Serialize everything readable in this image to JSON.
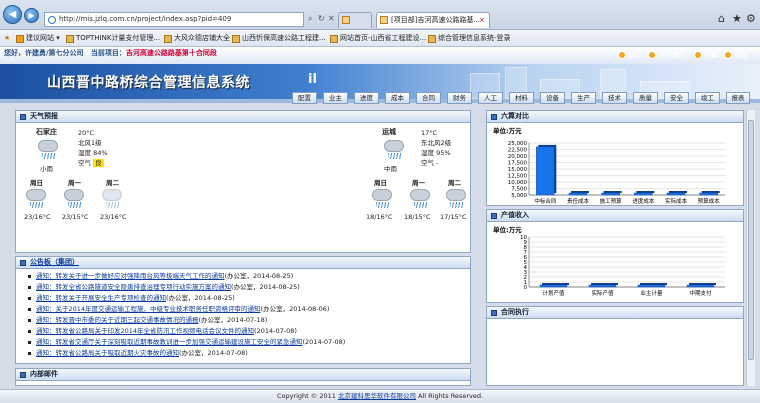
{
  "browser": {
    "url": "http://mis.jzlq.com.cn/project/index.asp?pid=409",
    "tabs": [
      "[项目部]吉河高速公路路基...",
      "[项目部]吉河高速公路路基..."
    ],
    "active_tab_close": "×"
  },
  "favorites": [
    "建议网站 ▾",
    "TOPTHINK计量支付管理...",
    "大风众德店铺大全",
    "山西忻保高速公路工程建...",
    "网站首页-山西省工程建设...",
    "综合管理信息系统-登录"
  ],
  "header": {
    "welcome": "您好，许建勇/第七分公司",
    "current_project_label": "当前项目：",
    "current_project": "吉河高速公路路基第十合同段",
    "system_title": "山西晋中路桥综合管理信息系统",
    "title_suffix": "il",
    "toplinks": [
      "首页",
      "项目首页",
      "帮助",
      "退出"
    ],
    "menu": [
      "配置",
      "业主",
      "进度",
      "成本",
      "合同",
      "财务",
      "人工",
      "材料",
      "设备",
      "生产",
      "技术",
      "质量",
      "安全",
      "竣工",
      "报表"
    ]
  },
  "weather": {
    "title": "天气预报",
    "cities": [
      {
        "name": "石家庄",
        "temp": "20°C",
        "wind": "北风1级",
        "humidity": "湿度 84%",
        "air_label": "空气",
        "air": "良",
        "condition": "小雨",
        "days": [
          {
            "day": "周日",
            "temp": "23/16°C"
          },
          {
            "day": "周一",
            "temp": "23/15°C"
          },
          {
            "day": "周二",
            "temp": "23/16°C"
          }
        ]
      },
      {
        "name": "运城",
        "temp": "17°C",
        "wind": "东北风2级",
        "humidity": "湿度 95%",
        "air_label": "空气",
        "air": "-",
        "condition": "中雨",
        "days": [
          {
            "day": "周日",
            "temp": "18/16°C"
          },
          {
            "day": "周一",
            "temp": "18/15°C"
          },
          {
            "day": "周二",
            "temp": "17/15°C"
          }
        ]
      }
    ]
  },
  "notices": {
    "title": "公告板（集团）",
    "items": [
      {
        "link": "通知：转发关于进一步做好应对强降雨台风等极端天气工作的通知",
        "src": "(办公室，2014-08-25)"
      },
      {
        "link": "通知：转发全省公路隧道安全隐患排查治理专项行动实施方案的通知",
        "src": "(办公室，2014-08-25)"
      },
      {
        "link": "通知：转发关于开展安全生产专项检查的通知",
        "src": "(办公室，2014-08-25)"
      },
      {
        "link": "通知：关于2014年度交通运输工程施、中级专业技术职务任职资格评审的通知",
        "src": "(办公室，2014-08-06)"
      },
      {
        "link": "通知：转发晋中市委的关于近期三起交通事故情况的通报",
        "src": "(办公室，2014-07-18)"
      },
      {
        "link": "通知：转发省公路局关于印发2014年全省防汛工作视频电话会议文件的通知",
        "src": "(2014-07-08)"
      },
      {
        "link": "通知：转发省交通厅关于深刻吸取近期事故教训进一步加强交通运输建设施工安全的紧急通知",
        "src": "(2014-07-08)"
      },
      {
        "link": "通知：转发省公路局关于吸取近期火灾事故的通知",
        "src": "(办公室，2014-07-08)"
      }
    ]
  },
  "internal_mail": {
    "title": "内部邮件"
  },
  "budget_panel": {
    "title": "六算对比",
    "unit": "单位:万元"
  },
  "output_panel": {
    "title": "产值收入",
    "unit": "单位:万元"
  },
  "contract_panel": {
    "title": "合同执行"
  },
  "chart_data": [
    {
      "type": "bar",
      "title": "六算对比",
      "ylabel": "单位:万元",
      "categories": [
        "中标合同",
        "责任成本",
        "施工预算",
        "进度成本",
        "实际成本",
        "预算成本"
      ],
      "values": [
        23500,
        500,
        500,
        500,
        500,
        500
      ],
      "yticks": [
        "25,000",
        "22,500",
        "20,000",
        "17,500",
        "15,000",
        "12,500",
        "10,000",
        "7,500",
        "5,000"
      ],
      "ylim": [
        5000,
        25000
      ]
    },
    {
      "type": "bar",
      "title": "产值收入",
      "ylabel": "单位:万元",
      "categories": [
        "计划产值",
        "实际产值",
        "业主计量",
        "中期支付"
      ],
      "values": [
        0,
        0,
        0,
        0
      ],
      "yticks": [
        "10",
        "9",
        "8",
        "7",
        "6",
        "5",
        "4",
        "3",
        "2",
        "1",
        "0"
      ],
      "ylim": [
        0,
        10
      ]
    }
  ],
  "footer": {
    "prefix": "Copyright © 2011 ",
    "company": "北京建科思华软件有限公司",
    "suffix": " All Rights Reserved."
  },
  "colors": {
    "bar": "#1a73e8",
    "header_blue": "#1c4fa0",
    "link": "#0b3b9c",
    "aqi": "#ffe400"
  }
}
